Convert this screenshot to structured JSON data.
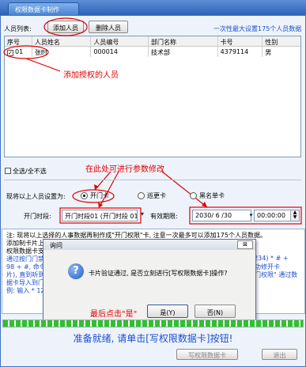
{
  "window": {
    "title": "权限数据卡制作"
  },
  "people": {
    "label": "人员列表:",
    "add_button": "添加人员",
    "delete_button": "删除人员",
    "limit_note": "一次性最大设置175个人员数据"
  },
  "table": {
    "columns": [
      "序号",
      "人员姓名",
      "人员编号",
      "部门名称",
      "卡号",
      "性别"
    ],
    "rows": [
      {
        "checked": true,
        "check_mark": "✓",
        "index": "01",
        "name": "张时",
        "emp_no": "000014",
        "dept": "技术部",
        "card_no": "4379114",
        "gender": "男"
      }
    ]
  },
  "annotations": {
    "added_people": "添加授权的人员",
    "modify_params": "在此处可进行参数修改",
    "click_yes_last": "最后点击\"是\""
  },
  "select_all": {
    "label": "全选/全不选",
    "checked": false
  },
  "settings": {
    "label": "现将以上人员设置为:",
    "options": [
      {
        "label": "开门卡",
        "selected": true
      },
      {
        "label": "巡更卡",
        "selected": false
      },
      {
        "label": "黑名单卡",
        "selected": false
      }
    ],
    "schedule_label": "开门时段:",
    "schedule_value": "开门时段01 (开门时段 01)",
    "validity_label": "有效期限:",
    "validity_date": "2030/ 6 /30",
    "validity_time": "00:00:00"
  },
  "notes": {
    "lines": [
      "注: 现将以上选择的人事数据再制作成\"开门权限\"卡, 注意一次最多可以添加175个人员数据。",
      "添加制卡片上的",
      "权限数据卡支持",
      "通过按门门禁",
      "98 + #, 命令输",
      "片), 直到听到",
      "据卡导入到门禁",
      "例: 输入 * 12"
    ],
    "right_lines": [
      "1234) * # +",
      "功修开卡",
      "门权限\" 通过数",
      ""
    ]
  },
  "dialog": {
    "title": "询问",
    "close_glyph": "⊠",
    "icon": "question-icon",
    "message": "卡片验证通过, 是否立刻进行[写权限数据卡]操作?",
    "yes_button": "是(Y)",
    "no_button": "否(N)"
  },
  "progress": {
    "value_percent": 100
  },
  "status": {
    "message": "准备就绪, 请单击[写权限数据卡]按钮!"
  },
  "footer": {
    "write_button": "写权限数据卡",
    "exit_button": "退出"
  },
  "colors": {
    "accent_blue": "#1a4fd0",
    "annotation_red": "#e00000",
    "progress_green": "#2fc12f"
  }
}
